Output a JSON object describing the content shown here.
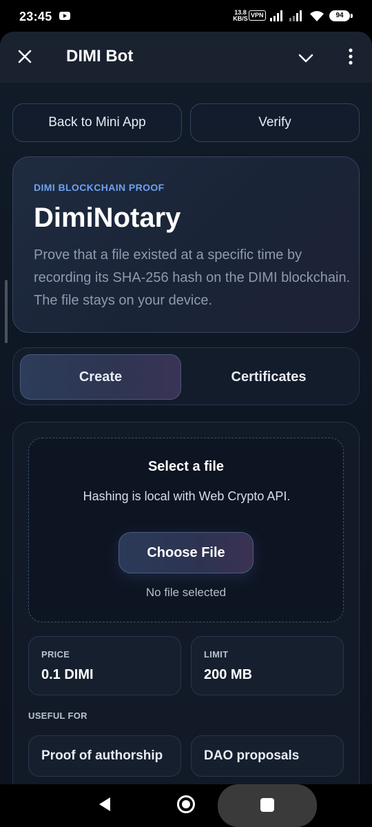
{
  "status_bar": {
    "time": "23:45",
    "net_speed_value": "13.8",
    "net_speed_unit": "KB/S",
    "vpn": "VPN",
    "battery": "94"
  },
  "header": {
    "title": "DIMI Bot"
  },
  "actions": {
    "back_label": "Back to Mini App",
    "verify_label": "Verify"
  },
  "hero": {
    "eyebrow": "DIMI BLOCKCHAIN PROOF",
    "title": "DimiNotary",
    "description": "Prove that a file existed at a specific time by recording its SHA-256 hash on the DIMI blockchain. The file stays on your device."
  },
  "tabs": [
    {
      "label": "Create",
      "active": true
    },
    {
      "label": "Certificates",
      "active": false
    }
  ],
  "dropzone": {
    "title": "Select a file",
    "description": "Hashing is local with Web Crypto API.",
    "button_label": "Choose File",
    "status": "No file selected"
  },
  "stats": {
    "price_label": "PRICE",
    "price_value": "0.1 DIMI",
    "limit_label": "LIMIT",
    "limit_value": "200 MB"
  },
  "useful_for": {
    "label": "USEFUL FOR",
    "items": [
      "Proof of authorship",
      "DAO proposals"
    ]
  },
  "icons": {
    "close": "close-icon",
    "chevron": "chevron-down-icon",
    "more": "more-vertical-icon"
  },
  "colors": {
    "accent": "#6ea2f0",
    "background": "#0f1724",
    "card_border": "#34445e"
  }
}
